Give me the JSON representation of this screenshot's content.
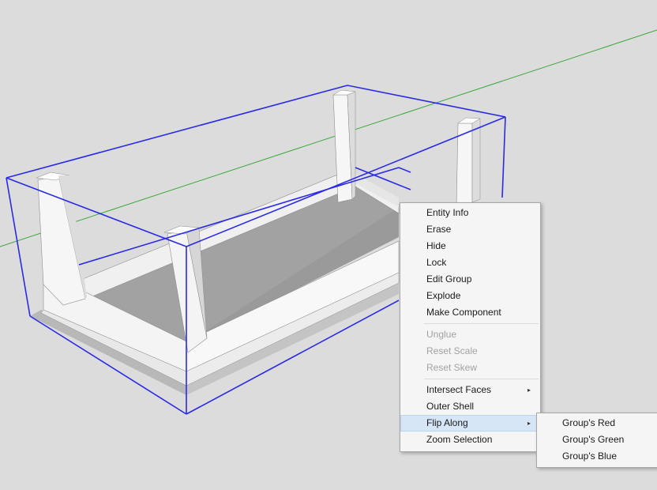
{
  "context_menu": {
    "items": [
      {
        "label": "Entity Info",
        "enabled": true
      },
      {
        "label": "Erase",
        "enabled": true
      },
      {
        "label": "Hide",
        "enabled": true
      },
      {
        "label": "Lock",
        "enabled": true
      },
      {
        "label": "Edit Group",
        "enabled": true
      },
      {
        "label": "Explode",
        "enabled": true
      },
      {
        "label": "Make Component",
        "enabled": true
      },
      {
        "label": "Unglue",
        "enabled": false
      },
      {
        "label": "Reset Scale",
        "enabled": false
      },
      {
        "label": "Reset Skew",
        "enabled": false
      },
      {
        "label": "Intersect Faces",
        "enabled": true,
        "has_submenu": true
      },
      {
        "label": "Outer Shell",
        "enabled": true
      },
      {
        "label": "Flip Along",
        "enabled": true,
        "has_submenu": true,
        "highlighted": true
      },
      {
        "label": "Zoom Selection",
        "enabled": true
      }
    ],
    "submenu_arrow": "▸"
  },
  "flip_submenu": {
    "items": [
      {
        "label": "Group's Red"
      },
      {
        "label": "Group's Green"
      },
      {
        "label": "Group's Blue"
      }
    ]
  },
  "colors": {
    "background": "#dcdcdc",
    "selection_outline": "#2a2ae6",
    "green_axis": "#3aa83a",
    "wood_face": "#f2f2f2",
    "floor_face": "#9a9a9a",
    "menu_highlight": "#d6e6f6"
  }
}
